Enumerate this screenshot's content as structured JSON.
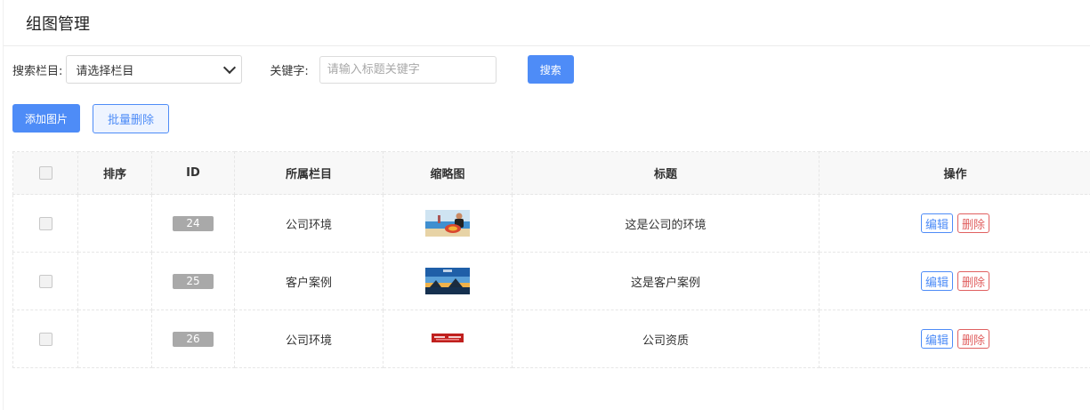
{
  "header": {
    "title": "组图管理"
  },
  "filters": {
    "category_label": "搜索栏目:",
    "category_selected": "请选择栏目",
    "keyword_label": "关键字:",
    "keyword_value": "",
    "keyword_placeholder": "请输入标题关键字",
    "search_label": "搜索"
  },
  "actions": {
    "add_label": "添加图片",
    "batch_delete_label": "批量删除"
  },
  "table": {
    "headers": {
      "sort": "排序",
      "id": "ID",
      "category": "所属栏目",
      "thumbnail": "缩略图",
      "title": "标题",
      "ops": "操作"
    },
    "rows": [
      {
        "sort": "",
        "id": "24",
        "category": "公司环境",
        "thumbnail": "beach-photo-thumbnail",
        "title": "这是公司的环境",
        "edit": "编辑",
        "delete": "删除"
      },
      {
        "sort": "",
        "id": "25",
        "category": "客户案例",
        "thumbnail": "sunset-photo-thumbnail",
        "title": "这是客户案例",
        "edit": "编辑",
        "delete": "删除"
      },
      {
        "sort": "",
        "id": "26",
        "category": "公司环境",
        "thumbnail": "red-banner-thumbnail",
        "title": "公司资质",
        "edit": "编辑",
        "delete": "删除"
      }
    ]
  },
  "colors": {
    "primary": "#4e8cf7",
    "danger": "#e06060",
    "id_badge": "#a9a9a9"
  }
}
